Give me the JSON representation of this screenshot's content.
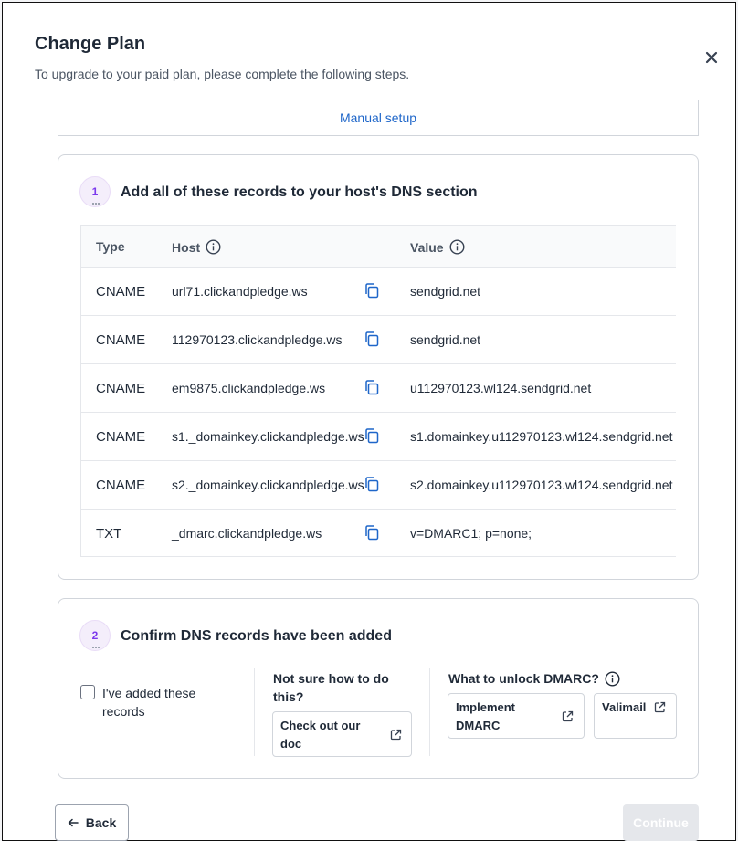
{
  "modal": {
    "title": "Change Plan",
    "subtitle": "To upgrade to your paid plan, please complete the following steps."
  },
  "tab": {
    "label": "Manual setup"
  },
  "step1": {
    "number": "1",
    "title": "Add all of these records to your host's DNS section",
    "columns": {
      "type": "Type",
      "host": "Host",
      "value": "Value"
    },
    "records": [
      {
        "type": "CNAME",
        "host": "url71.clickandpledge.ws",
        "value": "sendgrid.net"
      },
      {
        "type": "CNAME",
        "host": "112970123.clickandpledge.ws",
        "value": "sendgrid.net"
      },
      {
        "type": "CNAME",
        "host": "em9875.clickandpledge.ws",
        "value": "u112970123.wl124.sendgrid.net"
      },
      {
        "type": "CNAME",
        "host": "s1._domainkey.clickandpledge.ws",
        "value": "s1.domainkey.u112970123.wl124.sendgrid.net"
      },
      {
        "type": "CNAME",
        "host": "s2._domainkey.clickandpledge.ws",
        "value": "s2.domainkey.u112970123.wl124.sendgrid.net"
      },
      {
        "type": "TXT",
        "host": "_dmarc.clickandpledge.ws",
        "value": "v=DMARC1; p=none;"
      }
    ]
  },
  "step2": {
    "number": "2",
    "title": "Confirm DNS records have been added",
    "checkbox_label": "I've added these records",
    "help_heading": "Not sure how to do this?",
    "doc_button": "Check out our doc",
    "dmarc_heading": "What to unlock DMARC?",
    "implement_button": "Implement DMARC",
    "valimail_button": "Valimail"
  },
  "footer": {
    "back": "Back",
    "continue": "Continue"
  },
  "colors": {
    "accent": "#1e66c9",
    "step_badge": "#7c3aed",
    "disabled": "#e5e7eb"
  }
}
